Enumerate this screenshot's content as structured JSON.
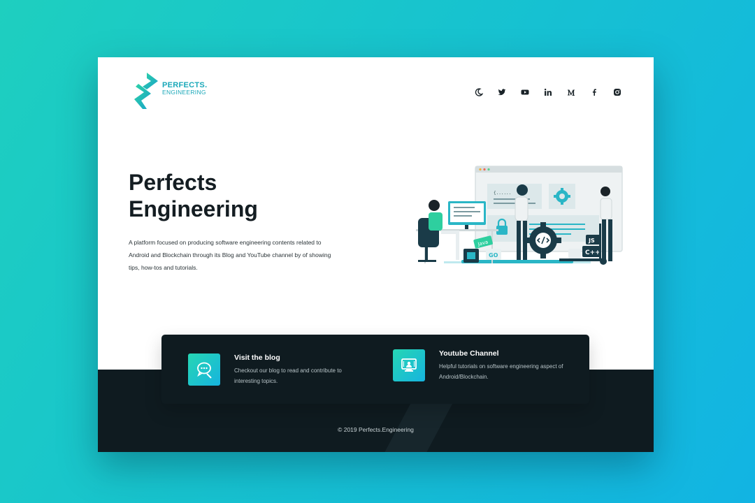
{
  "brand": {
    "line1": "PERFECTS.",
    "line2": "ENGINEERING"
  },
  "social": [
    {
      "icon": "moon-icon",
      "label": "theme toggle"
    },
    {
      "icon": "twitter-icon",
      "label": "Twitter"
    },
    {
      "icon": "youtube-icon",
      "label": "YouTube"
    },
    {
      "icon": "linkedin-icon",
      "label": "LinkedIn"
    },
    {
      "icon": "medium-icon",
      "label": "Medium"
    },
    {
      "icon": "facebook-icon",
      "label": "Facebook"
    },
    {
      "icon": "instagram-icon",
      "label": "Instagram"
    }
  ],
  "hero": {
    "title_line1": "Perfects",
    "title_line2": "Engineering",
    "description": "A platform  focused on producing software engineering contents related to Android and Blockchain through its Blog and YouTube channel by of showing tips, how-tos and tutorials."
  },
  "illustration": {
    "badges": [
      "Java",
      "GO",
      "JS",
      "C++"
    ],
    "code_snippet": "{......"
  },
  "cards": [
    {
      "title": "Visit the blog",
      "description": "Checkout our blog to read and contribute to interesting topics.",
      "icon": "chat-bubble-icon"
    },
    {
      "title": "Youtube Channel",
      "description": "Helpful tutorials on software engineering aspect of Android/Blockchain.",
      "icon": "video-monitor-icon"
    }
  ],
  "footer": {
    "copyright": "© 2019 Perfects.Engineering"
  },
  "colors": {
    "accent": "#1aa8b9",
    "dark": "#0f1b20",
    "gradient_start": "#26d6b3",
    "gradient_end": "#16b4df"
  }
}
